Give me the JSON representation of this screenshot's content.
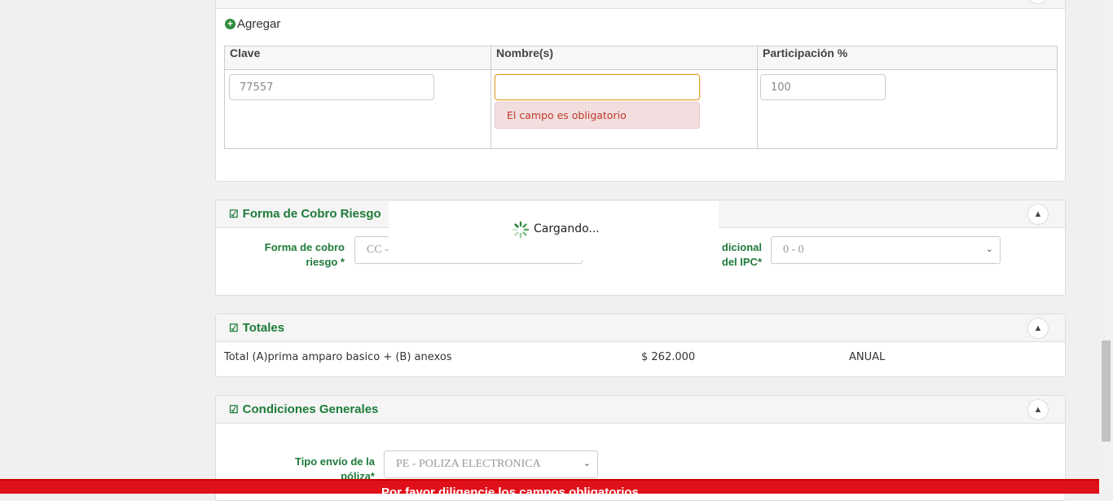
{
  "participants": {
    "add_label": "Agregar",
    "columns": [
      "Clave",
      "Nombre(s)",
      "Participación %"
    ],
    "row": {
      "clave": "77557",
      "nombre": "",
      "participacion": "100",
      "nombre_error": "El campo es obligatorio"
    }
  },
  "forma_cobro": {
    "title": "Forma de Cobro Riesgo",
    "field_label": "Forma de cobro riesgo *",
    "field_value": "CC -",
    "ipc_label": "dicional del IPC*",
    "ipc_value": "0 - 0"
  },
  "totales": {
    "title": "Totales",
    "row_label": "Total (A)prima amparo basico + (B) anexos",
    "amount": "$ 262.000",
    "period": "ANUAL"
  },
  "condiciones": {
    "title": "Condiciones Generales",
    "envio_label": "Tipo envío de la póliza*",
    "envio_value": "PE - POLIZA ELECTRONICA"
  },
  "loading": {
    "text": "Cargando..."
  },
  "footer": {
    "text": "Por favor diligencie los campos obligatorios"
  },
  "colors": {
    "accent_green": "#1e7b3a",
    "error_red": "#e0101a",
    "error_bg": "#f2dede"
  }
}
